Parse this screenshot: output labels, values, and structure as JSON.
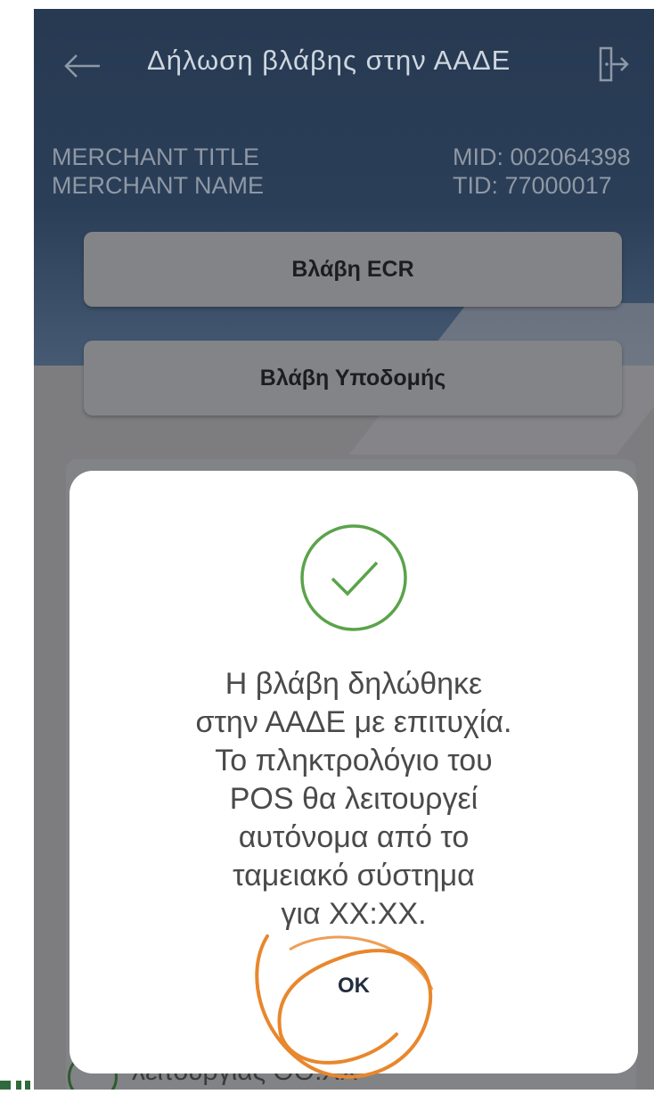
{
  "app": {
    "title": "Δήλωση βλάβης στην ΑΑΔΕ",
    "back_icon": "arrow-left-icon",
    "logout_icon": "logout-door-icon"
  },
  "merchant": {
    "title": "MERCHANT TITLE",
    "name": "MERCHANT NAME",
    "mid": "MID: 002064398",
    "tid": "TID: 77000017"
  },
  "menu": {
    "ecr_fault": "Βλάβη ECR",
    "infrastructure_fault": "Βλάβη Υποδομής"
  },
  "background_item_text": "λειτουργίας ΟΟ:ΧΧ",
  "dialog": {
    "icon": "checkmark-circle-icon",
    "message": "Η βλάβη δηλώθηκε\nστην ΑΑΔΕ με επιτυχία.\nΤο πληκτρολόγιο του\nPOS θα λειτουργεί\nαυτόνομα από το\nταμειακό σύστημα\nγια ΧΧ:ΧΧ.",
    "ok_label": "OK"
  },
  "colors": {
    "header": "#283a52",
    "success_green": "#5aa34a",
    "annotation_orange": "#e8872d"
  }
}
